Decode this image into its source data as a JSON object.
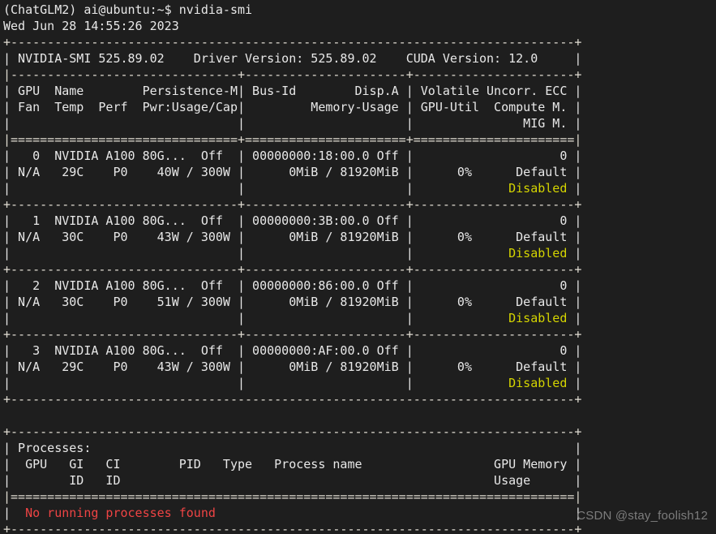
{
  "terminal": {
    "background_color": "#1e1e1e",
    "foreground_color": "#e8e8e8",
    "border_color": "#e0dcd2",
    "yellow_color": "#d4d400",
    "red_color": "#ef4444",
    "columns": 80,
    "rows": 33
  },
  "prompt": {
    "env": "(ChatGLM2)",
    "user_host": "ai@ubuntu",
    "path": "~",
    "symbol": "$",
    "command": "nvidia-smi",
    "full_line": "(ChatGLM2) ai@ubuntu:~$ nvidia-smi"
  },
  "timestamp": "Wed Jun 28 14:55:26 2023",
  "smi_header": {
    "smi_version_label": "NVIDIA-SMI",
    "smi_version": "525.89.02",
    "driver_label": "Driver Version:",
    "driver_version": "525.89.02",
    "cuda_label": "CUDA Version:",
    "cuda_version": "12.0",
    "line": "| NVIDIA-SMI 525.89.02    Driver Version: 525.89.02    CUDA Version: 12.0     |"
  },
  "table_headers": {
    "row1": "| GPU  Name        Persistence-M| Bus-Id        Disp.A | Volatile Uncorr. ECC |",
    "row2": "| Fan  Temp  Perf  Pwr:Usage/Cap|         Memory-Usage | GPU-Util  Compute M. |",
    "row3": "|                               |                      |               MIG M. |",
    "columns": [
      "GPU",
      "Name",
      "Persistence-M",
      "Bus-Id",
      "Disp.A",
      "Volatile Uncorr. ECC",
      "Fan",
      "Temp",
      "Perf",
      "Pwr:Usage/Cap",
      "Memory-Usage",
      "GPU-Util",
      "Compute M.",
      "MIG M."
    ]
  },
  "rules": {
    "top": "+-----------------------------------------------------------------------------+",
    "mid": "|-------------------------------+----------------------+----------------------+",
    "double": "|===============================+======================+======================|",
    "sep": "+-------------------------------+----------------------+----------------------+",
    "bottom": "+-----------------------------------------------------------------------------+",
    "proc_top": "+-----------------------------------------------------------------------------+",
    "proc_double": "|=============================================================================|",
    "proc_bottom": "+-----------------------------------------------------------------------------+"
  },
  "gpus": [
    {
      "index": "0",
      "name": "NVIDIA A100 80G...",
      "persistence_m": "Off",
      "bus_id": "00000000:18:00.0",
      "disp_a": "Off",
      "ecc": "0",
      "fan": "N/A",
      "temp": "29C",
      "perf": "P0",
      "power": "40W / 300W",
      "memory": "0MiB / 81920MiB",
      "util": "0%",
      "compute_m": "Default",
      "mig_m": "Disabled",
      "line1": "|   0  NVIDIA A100 80G...  Off  | 00000000:18:00.0 Off |                    0 |",
      "line2": "| N/A   29C    P0    40W / 300W |      0MiB / 81920MiB |      0%      Default |",
      "line3_pre": "|                               |                      |             ",
      "line3_post": " |"
    },
    {
      "index": "1",
      "name": "NVIDIA A100 80G...",
      "persistence_m": "Off",
      "bus_id": "00000000:3B:00.0",
      "disp_a": "Off",
      "ecc": "0",
      "fan": "N/A",
      "temp": "30C",
      "perf": "P0",
      "power": "43W / 300W",
      "memory": "0MiB / 81920MiB",
      "util": "0%",
      "compute_m": "Default",
      "mig_m": "Disabled",
      "line1": "|   1  NVIDIA A100 80G...  Off  | 00000000:3B:00.0 Off |                    0 |",
      "line2": "| N/A   30C    P0    43W / 300W |      0MiB / 81920MiB |      0%      Default |",
      "line3_pre": "|                               |                      |             ",
      "line3_post": " |"
    },
    {
      "index": "2",
      "name": "NVIDIA A100 80G...",
      "persistence_m": "Off",
      "bus_id": "00000000:86:00.0",
      "disp_a": "Off",
      "ecc": "0",
      "fan": "N/A",
      "temp": "30C",
      "perf": "P0",
      "power": "51W / 300W",
      "memory": "0MiB / 81920MiB",
      "util": "0%",
      "compute_m": "Default",
      "mig_m": "Disabled",
      "line1": "|   2  NVIDIA A100 80G...  Off  | 00000000:86:00.0 Off |                    0 |",
      "line2": "| N/A   30C    P0    51W / 300W |      0MiB / 81920MiB |      0%      Default |",
      "line3_pre": "|                               |                      |             ",
      "line3_post": " |"
    },
    {
      "index": "3",
      "name": "NVIDIA A100 80G...",
      "persistence_m": "Off",
      "bus_id": "00000000:AF:00.0",
      "disp_a": "Off",
      "ecc": "0",
      "fan": "N/A",
      "temp": "29C",
      "perf": "P0",
      "power": "43W / 300W",
      "memory": "0MiB / 81920MiB",
      "util": "0%",
      "compute_m": "Default",
      "mig_m": "Disabled",
      "line1": "|   3  NVIDIA A100 80G...  Off  | 00000000:AF:00.0 Off |                    0 |",
      "line2": "| N/A   29C    P0    43W / 300W |      0MiB / 81920MiB |      0%      Default |",
      "line3_pre": "|                               |                      |             ",
      "line3_post": " |"
    }
  ],
  "processes": {
    "title": "| Processes:                                                                  |",
    "header1": "|  GPU   GI   CI        PID   Type   Process name                  GPU Memory |",
    "header2": "|        ID   ID                                                   Usage      |",
    "empty_pre": "|  ",
    "empty_message": "No running processes found",
    "empty_post": "                                                 |",
    "columns": [
      "GPU",
      "GI ID",
      "CI ID",
      "PID",
      "Type",
      "Process name",
      "GPU Memory Usage"
    ],
    "message": "No running processes found"
  },
  "watermark": "CSDN @stay_foolish12"
}
